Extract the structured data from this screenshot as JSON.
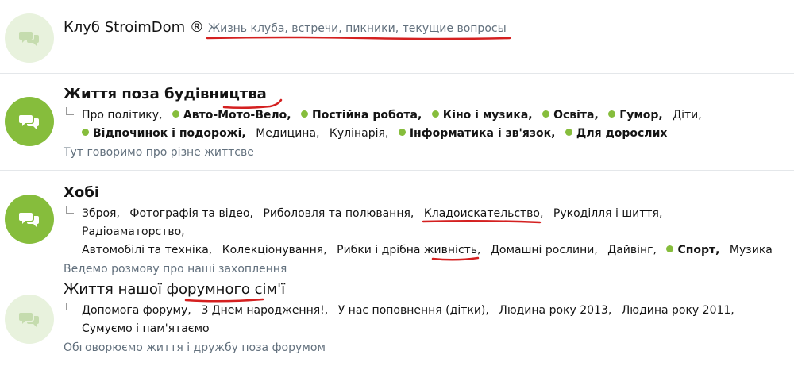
{
  "nodes": [
    {
      "title": "Клуб StroimDom ®",
      "description": "Жизнь клуба, встречи, пикники, текущие вопросы",
      "icon": "chat-bubbles-icon",
      "unread": false,
      "subforums": []
    },
    {
      "title": "Життя поза будівництва",
      "description": "Тут говоримо про різне життєве",
      "icon": "chat-bubbles-icon",
      "unread": true,
      "subforums": [
        {
          "label": "Про політику,",
          "unread": false
        },
        {
          "label": "Авто-Мото-Вело,",
          "unread": true
        },
        {
          "label": "Постійна робота,",
          "unread": true
        },
        {
          "label": "Кіно і музика,",
          "unread": true
        },
        {
          "label": "Освіта,",
          "unread": true
        },
        {
          "label": "Гумор,",
          "unread": true
        },
        {
          "label": "Діти,",
          "unread": false
        },
        {
          "label": "Відпочинок і подорожі,",
          "unread": true
        },
        {
          "label": "Медицина,",
          "unread": false
        },
        {
          "label": "Кулінарія,",
          "unread": false
        },
        {
          "label": "Інформатика і зв'язок,",
          "unread": true
        },
        {
          "label": "Для дорослих",
          "unread": true
        }
      ]
    },
    {
      "title": "Хобі",
      "description": "Ведемо розмову про наші захоплення",
      "icon": "chat-bubbles-icon",
      "unread": true,
      "subforums": [
        {
          "label": "Зброя,",
          "unread": false
        },
        {
          "label": "Фотографія та відео,",
          "unread": false
        },
        {
          "label": "Риболовля та полювання,",
          "unread": false
        },
        {
          "label": "Кладоискательство,",
          "unread": false
        },
        {
          "label": "Рукоділля і шиття,",
          "unread": false
        },
        {
          "label": "Радіоаматорство,",
          "unread": false
        },
        {
          "label": "Автомобілі та техніка,",
          "unread": false
        },
        {
          "label": "Колекціонування,",
          "unread": false
        },
        {
          "label": "Рибки і дрібна живність,",
          "unread": false
        },
        {
          "label": "Домашні рослини,",
          "unread": false
        },
        {
          "label": "Дайвінг,",
          "unread": false
        },
        {
          "label": "Спорт,",
          "unread": true
        },
        {
          "label": "Музика",
          "unread": false
        }
      ]
    },
    {
      "title": "Життя нашої форумного сім'ї",
      "description": "Обговорюємо життя і дружбу поза форумом",
      "icon": "chat-bubbles-icon",
      "unread": false,
      "subforums": [
        {
          "label": "Допомога форуму,",
          "unread": false
        },
        {
          "label": "З Днем народження!,",
          "unread": false
        },
        {
          "label": "У нас поповнення (дітки),",
          "unread": false
        },
        {
          "label": "Людина року 2013,",
          "unread": false
        },
        {
          "label": "Людина року 2011,",
          "unread": false
        },
        {
          "label": "Сумуємо і пам'ятаємо",
          "unread": false
        }
      ]
    }
  ],
  "colors": {
    "unread_icon": "#86bd3c",
    "read_icon": "#e8f2dd",
    "description": "#62707d",
    "annotation_marker": "#d42020"
  }
}
